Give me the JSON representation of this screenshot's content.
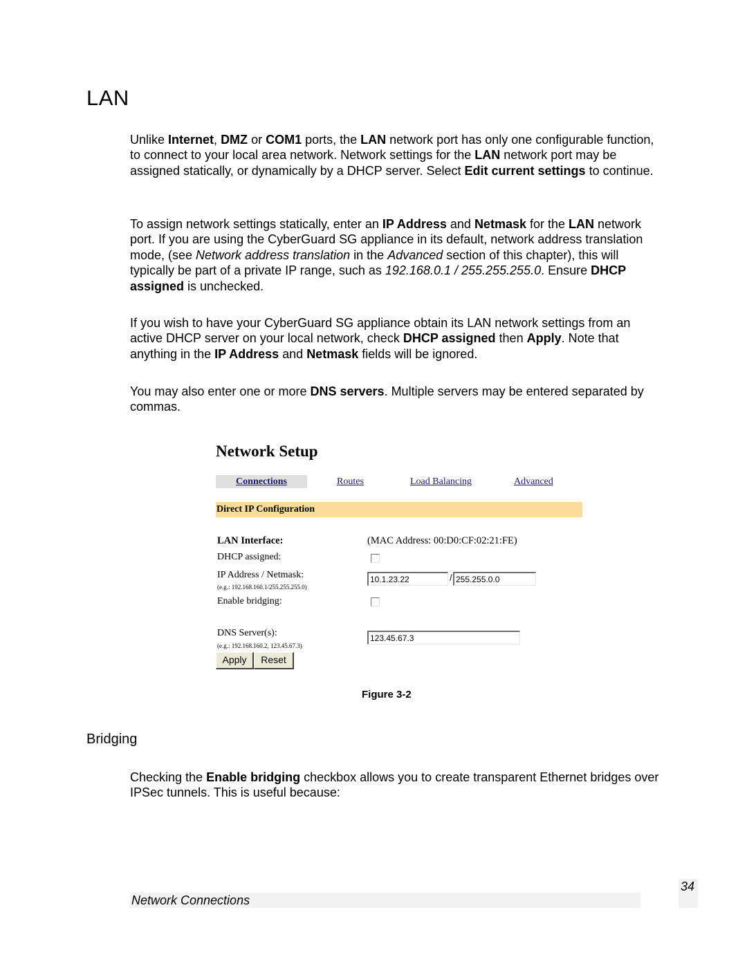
{
  "title": "LAN",
  "paragraphs": {
    "p1": [
      {
        "t": "Unlike "
      },
      {
        "t": "Internet",
        "b": true
      },
      {
        "t": ", "
      },
      {
        "t": "DMZ",
        "b": true
      },
      {
        "t": " or "
      },
      {
        "t": "COM1",
        "b": true
      },
      {
        "t": " ports, the "
      },
      {
        "t": "LAN",
        "b": true
      },
      {
        "t": " network port has only one configurable function, to connect to your local area network.  Network settings for the "
      },
      {
        "t": "LAN",
        "b": true
      },
      {
        "t": " network port may be assigned statically, or dynamically by a DHCP server.  Select "
      },
      {
        "t": "Edit current settings",
        "b": true
      },
      {
        "t": " to continue."
      }
    ],
    "p2": [
      {
        "t": "To assign network settings statically, enter an "
      },
      {
        "t": "IP Address",
        "b": true
      },
      {
        "t": " and "
      },
      {
        "t": "Netmask",
        "b": true
      },
      {
        "t": " for the "
      },
      {
        "t": "LAN",
        "b": true
      },
      {
        "t": " network port.  If you are using the CyberGuard SG appliance in its default, network address translation mode, (see "
      },
      {
        "t": "Network address translation",
        "i": true
      },
      {
        "t": " in the "
      },
      {
        "t": "Advanced",
        "i": true
      },
      {
        "t": " section of this chapter), this will typically be part of a private IP range, such as "
      },
      {
        "t": "192.168.0.1 / 255.255.255.0",
        "i": true
      },
      {
        "t": ".  Ensure "
      },
      {
        "t": "DHCP assigned",
        "b": true
      },
      {
        "t": " is unchecked."
      }
    ],
    "p3": [
      {
        "t": "If you wish to have your CyberGuard SG appliance obtain its LAN network settings from an active DHCP server on your local network, check "
      },
      {
        "t": "DHCP assigned",
        "b": true
      },
      {
        "t": " then "
      },
      {
        "t": "Apply",
        "b": true
      },
      {
        "t": ".  Note that anything in the "
      },
      {
        "t": "IP Address",
        "b": true
      },
      {
        "t": " and "
      },
      {
        "t": "Netmask",
        "b": true
      },
      {
        "t": " fields will be ignored."
      }
    ],
    "p4": [
      {
        "t": "You may also enter one or more "
      },
      {
        "t": "DNS servers",
        "b": true
      },
      {
        "t": ".  Multiple servers may be entered separated by commas."
      }
    ],
    "p5": [
      {
        "t": "Checking the "
      },
      {
        "t": "Enable bridging",
        "b": true
      },
      {
        "t": " checkbox allows you to create transparent Ethernet bridges over IPSec tunnels.  This is useful because:"
      }
    ]
  },
  "figure": {
    "title": "Network Setup",
    "tabs": [
      {
        "label": "Connections",
        "active": true
      },
      {
        "label": "Routes",
        "active": false
      },
      {
        "label": "Load Balancing",
        "active": false
      },
      {
        "label": "Advanced",
        "active": false
      }
    ],
    "section": "Direct IP Configuration",
    "lan_interface_label": "LAN Interface:",
    "mac_address": "(MAC Address: 00:D0:CF:02:21:FE)",
    "dhcp_label": "DHCP assigned:",
    "dhcp_checked": false,
    "ip_label": "IP Address / Netmask:",
    "ip_hint": "(e.g.: 192.168.160.1/255.255.255.0)",
    "ip_value": "10.1.23.22",
    "separator": "/",
    "netmask_value": "255.255.0.0",
    "bridge_label": "Enable bridging:",
    "bridge_checked": false,
    "dns_label": "DNS Server(s):",
    "dns_hint": "(e.g.: 192.168.160.2, 123.45.67.3)",
    "dns_value": "123.45.67.3",
    "apply_label": "Apply",
    "reset_label": "Reset",
    "caption": "Figure 3-2",
    "colors": {
      "section_bar": "#fddc9a",
      "active_tab": "#e0e0e0",
      "link": "#1a1a6e"
    }
  },
  "bridging_heading": "Bridging",
  "footer": {
    "section": "Network Connections",
    "page_number": "34"
  }
}
